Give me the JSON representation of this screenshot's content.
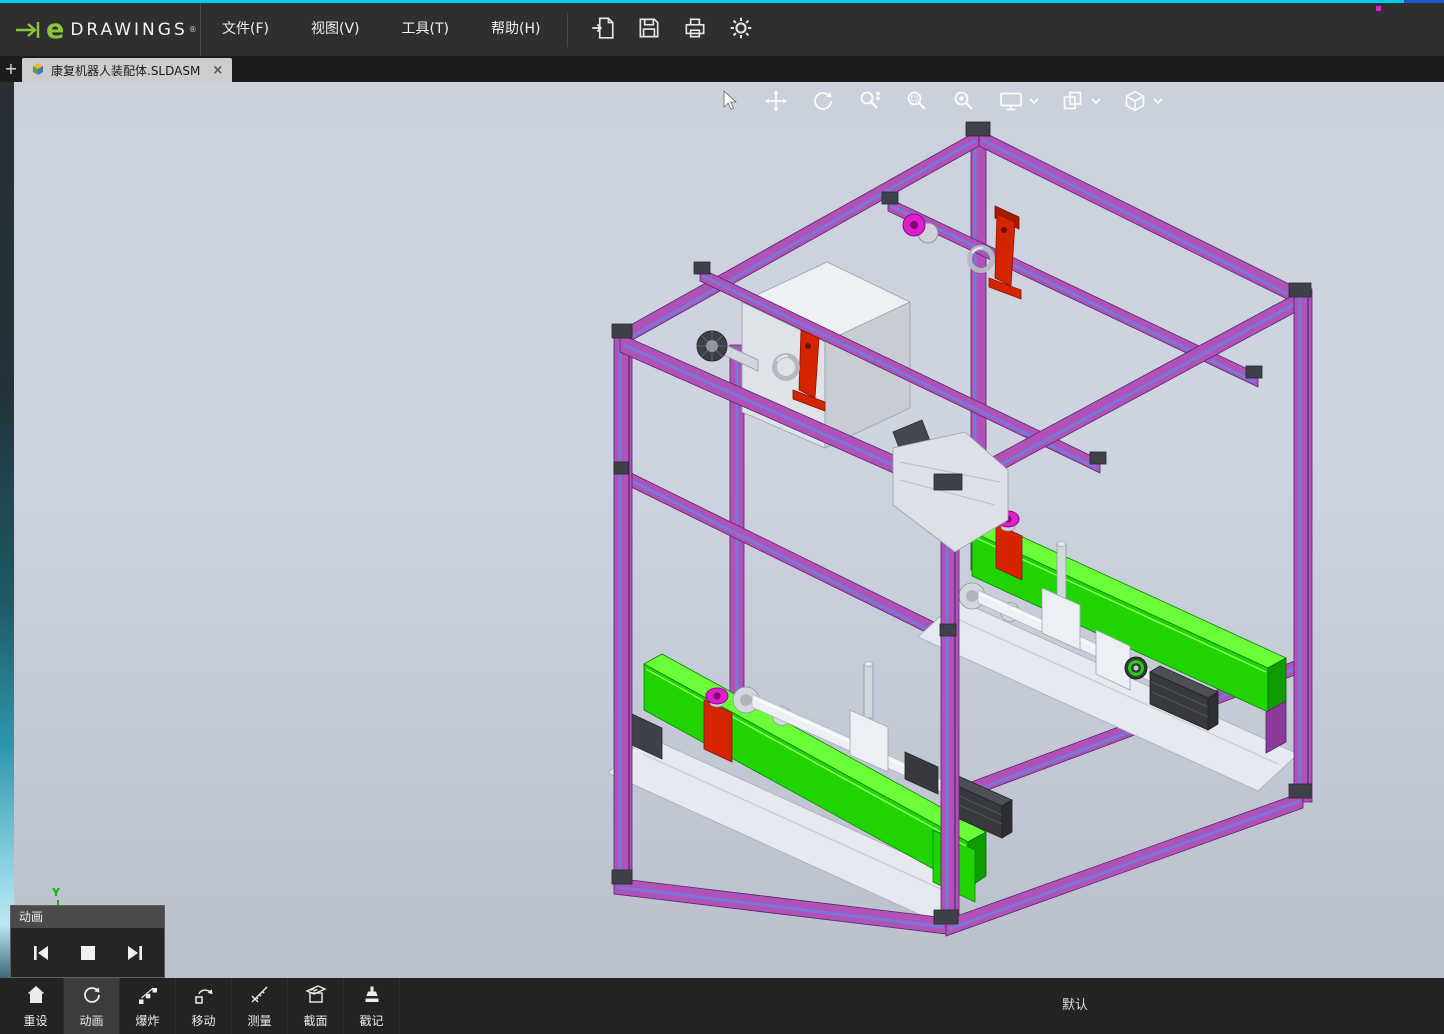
{
  "colors": {
    "menubar-bg": "#2f2f2f",
    "tabbar-bg": "#1c1c1c",
    "tab-active-bg": "#cdcdcd",
    "bottombar-bg": "#232323",
    "panel-header-bg": "#4a4a4a",
    "logo-green": "#8cc63e",
    "viewport-top": "#cbd1dc",
    "viewport-bottom": "#bac0cc",
    "frame-purple": "#b052b8",
    "frame-blue": "#7878d8",
    "beam-green": "#1fd400",
    "beam-green-light": "#6aff38",
    "beam-green-dark": "#0f9c00",
    "part-red": "#d42400",
    "part-magenta": "#e01ccc",
    "triad-green": "#00bb00",
    "top-edge-cyan": "#00ccee",
    "top-edge-blue": "#2255cc"
  },
  "menubar": {
    "logo": {
      "e": "e",
      "text": "DRAWINGS",
      "reg": "®"
    },
    "menus": [
      {
        "label": "文件(F)"
      },
      {
        "label": "视图(V)"
      },
      {
        "label": "工具(T)"
      },
      {
        "label": "帮助(H)"
      }
    ],
    "tools": [
      {
        "name": "open-file"
      },
      {
        "name": "save"
      },
      {
        "name": "print"
      },
      {
        "name": "settings"
      }
    ]
  },
  "tabbar": {
    "new_tab": "+",
    "tab": {
      "icon": "assembly-icon",
      "title": "康复机器人装配体.SLDASM",
      "close": "×"
    }
  },
  "viewport": {
    "tools": [
      "select",
      "pan",
      "rotate",
      "zoom",
      "zoom-window",
      "zoom-fit",
      "display-mode",
      "split-view",
      "orientation-cube"
    ],
    "triad": {
      "y": "Y"
    }
  },
  "animation_panel": {
    "title": "动画",
    "buttons": [
      {
        "name": "previous-frame"
      },
      {
        "name": "stop"
      },
      {
        "name": "next-frame"
      }
    ]
  },
  "bottom_toolbar": {
    "items": [
      {
        "label": "重设",
        "icon": "home",
        "active": false
      },
      {
        "label": "动画",
        "icon": "animation",
        "active": true
      },
      {
        "label": "爆炸",
        "icon": "explode",
        "active": false
      },
      {
        "label": "移动",
        "icon": "move",
        "active": false
      },
      {
        "label": "测量",
        "icon": "measure",
        "active": false
      },
      {
        "label": "截面",
        "icon": "section",
        "active": false
      },
      {
        "label": "戳记",
        "icon": "stamp",
        "active": false
      }
    ],
    "configuration": "默认"
  }
}
